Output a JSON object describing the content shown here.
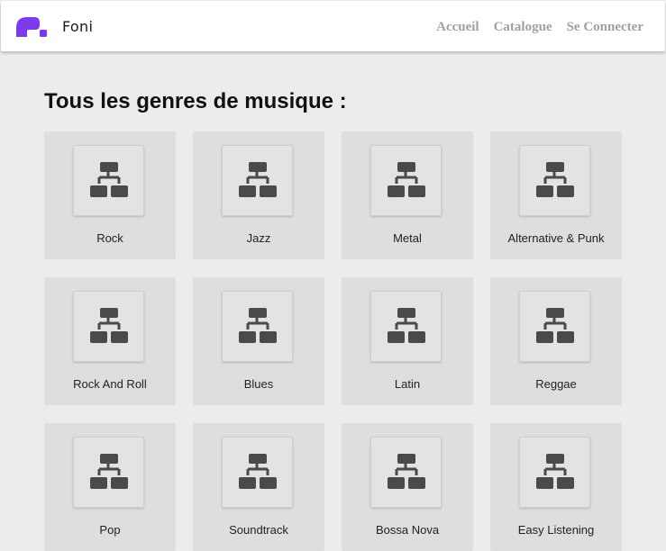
{
  "brand": {
    "name": "Foni",
    "logo_icon": "foni-logo-icon",
    "accent_color": "#7c3aed"
  },
  "nav": {
    "links": [
      {
        "label": "Accueil"
      },
      {
        "label": "Catalogue"
      },
      {
        "label": "Se Connecter"
      }
    ]
  },
  "page": {
    "title": "Tous les genres de musique :"
  },
  "genre_icon": "sitemap-icon",
  "genres": [
    {
      "label": "Rock"
    },
    {
      "label": "Jazz"
    },
    {
      "label": "Metal"
    },
    {
      "label": "Alternative & Punk"
    },
    {
      "label": "Rock And Roll"
    },
    {
      "label": "Blues"
    },
    {
      "label": "Latin"
    },
    {
      "label": "Reggae"
    },
    {
      "label": "Pop"
    },
    {
      "label": "Soundtrack"
    },
    {
      "label": "Bossa Nova"
    },
    {
      "label": "Easy Listening"
    }
  ]
}
